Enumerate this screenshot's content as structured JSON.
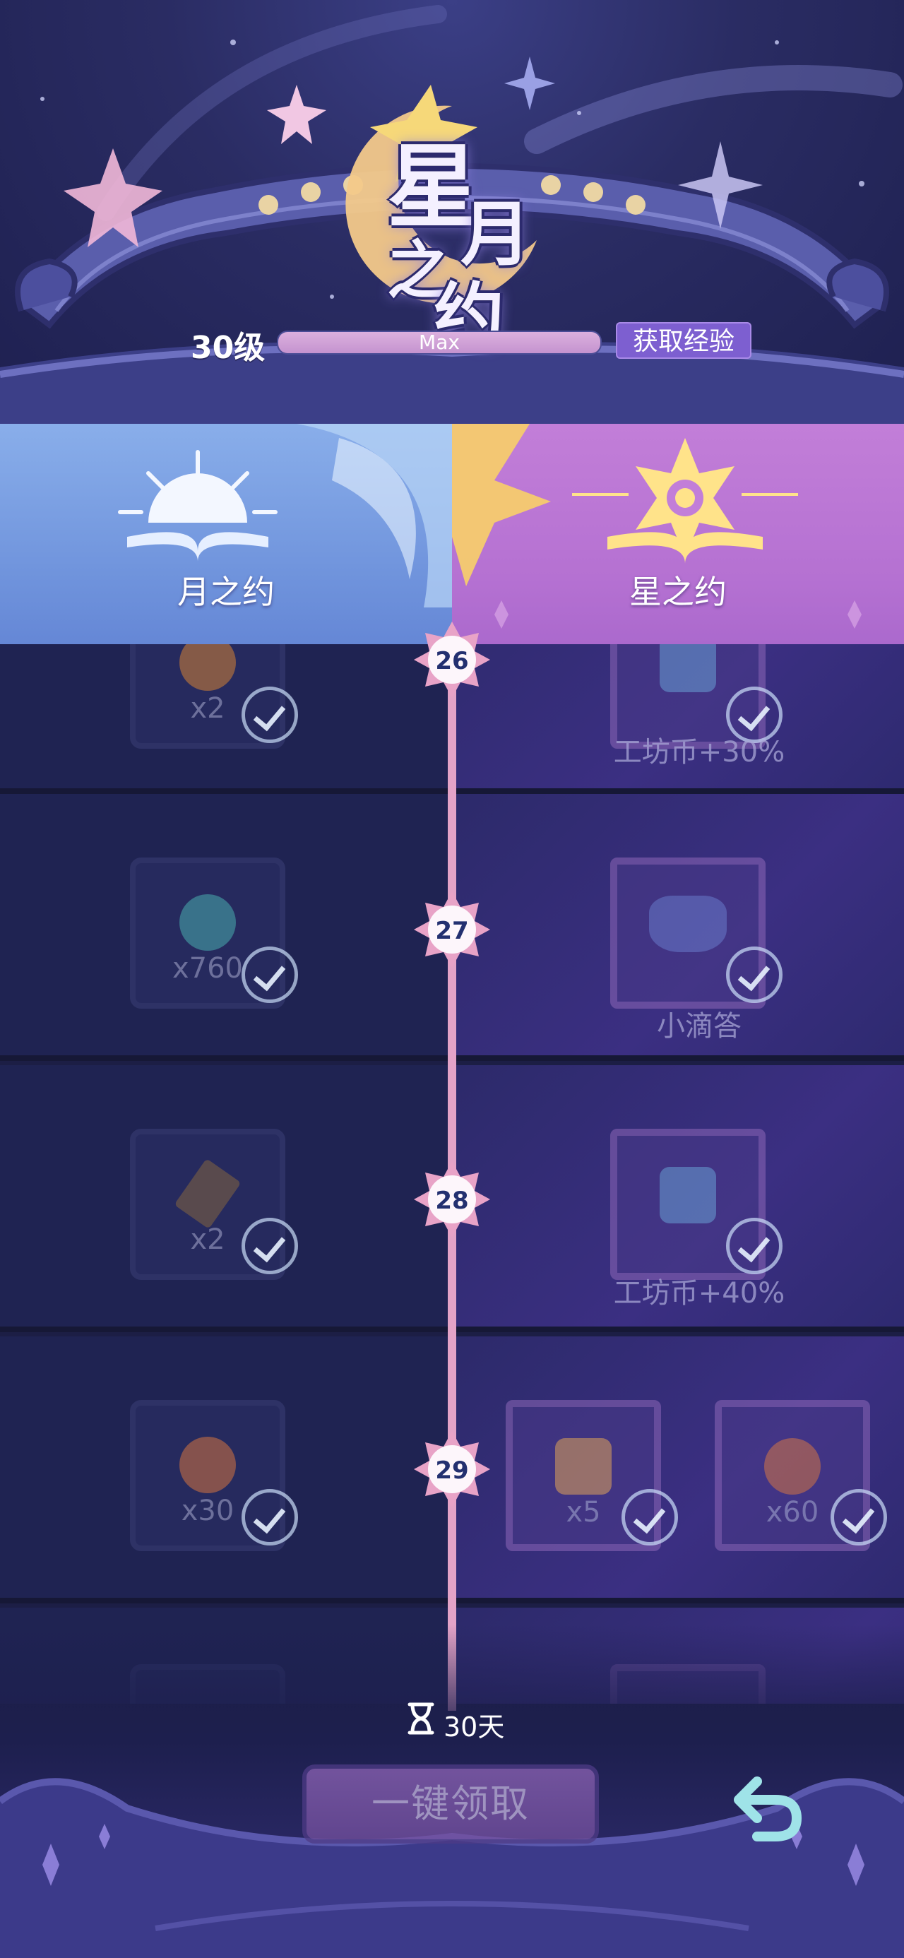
{
  "header": {
    "logo_chars": [
      "星",
      "月",
      "之",
      "约"
    ],
    "level_label": "30级",
    "xp_text": "Max",
    "xp_progress": 1.0,
    "xp_button_label": "获取经验"
  },
  "tabs": [
    {
      "label": "月之约",
      "icon": "sunrise-book-icon",
      "color": "#7a9fe2"
    },
    {
      "label": "星之约",
      "icon": "star-book-icon",
      "color": "#b776d3"
    }
  ],
  "rows": [
    {
      "level": "26",
      "free_qty": "x2",
      "free_icon": "jar-icon",
      "prem_qty": "",
      "prem_name": "工坊币+30%",
      "prem_icon": "scroll-coin-icon"
    },
    {
      "level": "27",
      "free_qty": "x760",
      "free_icon": "star-coin-icon",
      "prem_qty": "",
      "prem_name": "小滴答",
      "prem_icon": "watering-can-icon"
    },
    {
      "level": "28",
      "free_qty": "x2",
      "free_icon": "pickaxe-icon",
      "prem_qty": "",
      "prem_name": "工坊币+40%",
      "prem_icon": "scroll-coin-icon"
    },
    {
      "level": "29",
      "free_qty": "x30",
      "free_icon": "flower-coin-icon",
      "prem_items": [
        {
          "qty": "x5",
          "icon": "paint-bucket-icon"
        },
        {
          "qty": "x60",
          "icon": "flower-coin-icon"
        }
      ]
    }
  ],
  "footer": {
    "timer_text": "30天",
    "claim_all_label": "一键领取",
    "back_icon": "back-arrow-icon"
  },
  "colors": {
    "accent_pink": "#e3a3c7",
    "moon_blue": "#7a9fe2",
    "star_purple": "#b776d3"
  }
}
